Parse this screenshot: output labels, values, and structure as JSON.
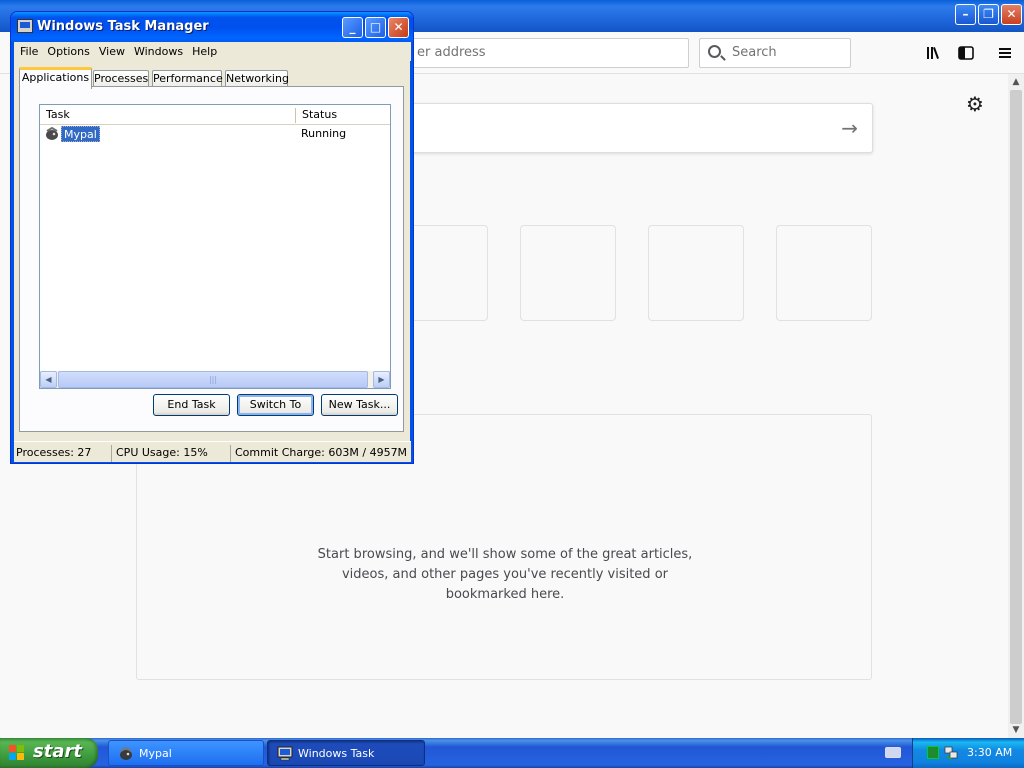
{
  "browser": {
    "url_placeholder": "er address",
    "search_placeholder": "Search",
    "highlights_text": [
      "Start browsing, and we'll show some of the great articles,",
      "videos, and other pages you've recently visited or",
      "bookmarked here."
    ],
    "icons": [
      "library-icon",
      "sidebar-icon",
      "menu-icon",
      "gear-icon",
      "arrow-right-icon"
    ]
  },
  "task_manager": {
    "title": "Windows Task Manager",
    "menu": [
      "File",
      "Options",
      "View",
      "Windows",
      "Help"
    ],
    "tabs": [
      "Applications",
      "Processes",
      "Performance",
      "Networking"
    ],
    "active_tab": "Applications",
    "list": {
      "columns": [
        "Task",
        "Status"
      ],
      "rows": [
        {
          "task": "Mypal",
          "status": "Running"
        }
      ]
    },
    "buttons": {
      "end_task": "End Task",
      "switch_to": "Switch To",
      "new_task": "New Task..."
    },
    "status": {
      "processes": "Processes: 27",
      "cpu": "CPU Usage: 15%",
      "commit": "Commit Charge: 603M / 4957M"
    }
  },
  "taskbar": {
    "start_label": "start",
    "tasks": [
      {
        "label": "Mypal"
      },
      {
        "label": "Windows Task Manager"
      }
    ],
    "clock": "3:30 AM"
  }
}
